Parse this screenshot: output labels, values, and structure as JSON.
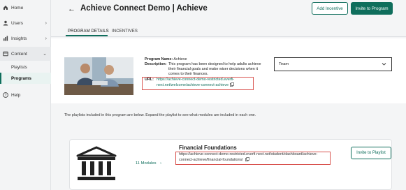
{
  "sidebar": {
    "items": [
      {
        "label": "Home",
        "icon": "home-icon"
      },
      {
        "label": "Users",
        "icon": "users-icon"
      },
      {
        "label": "Insights",
        "icon": "insights-icon"
      },
      {
        "label": "Content",
        "icon": "content-icon"
      },
      {
        "label": "Help",
        "icon": "help-icon"
      }
    ],
    "sub_items": [
      {
        "label": "Playlists"
      },
      {
        "label": "Programs"
      }
    ]
  },
  "header": {
    "back_glyph": "←",
    "title": "Achieve Connect Demo | Achieve",
    "add_incentive_label": "Add Incentive",
    "invite_label": "Invite to Program"
  },
  "tabs": [
    {
      "label": "PROGRAM DETAILS",
      "active": true
    },
    {
      "label": "INCENTIVES",
      "active": false
    }
  ],
  "program": {
    "name_label": "Program Name:",
    "name_value": "Achieve",
    "description_label": "Description:",
    "description_value": "This program has been designed to help adults achieve their financial goals and make wiser decisions when it comes to their finances.",
    "url_label": "URL:",
    "url_value": "https://achieve-connect-demo-restricted.everfi-next.net/welcome/achieve-connect-achieve"
  },
  "audience_select": {
    "value": "Team"
  },
  "help_text": "The playlists included in this program are below. Expand the playlist to see what modules are included in each one.",
  "playlist": {
    "title": "Financial Foundations",
    "modules_label": "11 Modules",
    "url": "https://achieve-connect-demo-restricted.everfi-next.net/student/dashboard/achieve-connect-achieve/financial-foundations/",
    "invite_label": "Invite to Playlist"
  },
  "colors": {
    "accent": "#0f6e5c",
    "highlight": "#d9534f"
  }
}
